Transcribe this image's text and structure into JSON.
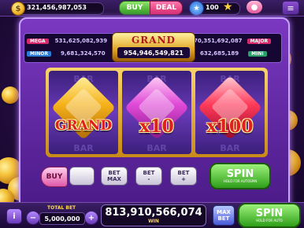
{
  "top_bar": {
    "coin_balance": "321,456,987,053",
    "coin_symbol": "$",
    "buy_label": "BUY",
    "deal_label": "DEAL",
    "level": "100",
    "menu_glyph": "≡"
  },
  "jackpots": {
    "mega": {
      "label": "MEGA",
      "value": "531,625,082,939"
    },
    "minor": {
      "label": "MINOR",
      "value": "9,681,324,570"
    },
    "grand": {
      "label": "GRAND",
      "value": "954,946,549,821"
    },
    "major": {
      "label": "MAJOR",
      "value": "70,351,692,087"
    },
    "mini": {
      "label": "MINI",
      "value": "632,685,189"
    }
  },
  "reels": [
    {
      "label": "GRAND",
      "gem_color": "#f5b21a",
      "ghost_top": "BAR",
      "ghost_bottom": "BAR"
    },
    {
      "label": "x10",
      "gem_color": "#e04ad8",
      "ghost_top": "BAR",
      "ghost_bottom": "BAR"
    },
    {
      "label": "x100",
      "gem_color": "#ff3a5a",
      "ghost_top": "BAR",
      "ghost_bottom": "BAR"
    }
  ],
  "controls": {
    "buy": "BUY",
    "bet_max_line1": "BET",
    "bet_max_line2": "MAX",
    "bet_minus_line1": "BET",
    "bet_minus_line2": "-",
    "bet_plus_line1": "BET",
    "bet_plus_line2": "+",
    "spin": "SPIN",
    "spin_hint": "HOLD FOR AUTOSPIN"
  },
  "bottom_bar": {
    "total_bet_label": "TOTAL BET",
    "total_bet": "5,000,000",
    "minus": "−",
    "plus": "+",
    "win_value": "813,910,566,074",
    "win_label": "WIN",
    "max_bet_line1": "MAX",
    "max_bet_line2": "BET",
    "spin": "SPIN",
    "spin_hint": "HOLD FOR AUTO"
  },
  "colors": {
    "accent_purple": "#7a38c0",
    "spin_green": "#2e9e1a",
    "gold": "#f5c23a"
  }
}
